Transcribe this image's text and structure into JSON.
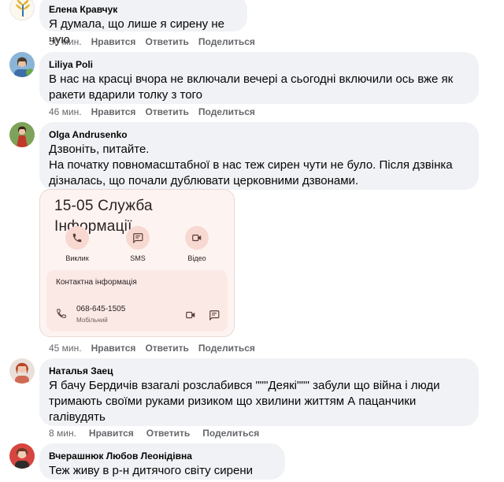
{
  "comments": [
    {
      "author": "Елена Кравчук",
      "text": "Я думала, що лише я сирену не чую",
      "time": "50 мин.",
      "like": "Нравится",
      "reply": "Ответить",
      "share": "Поделиться"
    },
    {
      "author": "Liliya Poli",
      "text": "В нас на красці вчора не включали вечері а сьогодні включили ось вже як\nракети вдарили толку з того",
      "time": "46 мин.",
      "like": "Нравится",
      "reply": "Ответить",
      "share": "Поделиться"
    },
    {
      "author": "Olga Andrusenko",
      "text": "Дзвоніть, питайте.\nНа початку повномасштабної в нас теж сирен чути не було. Після дзвінка\nдізналась, що почали дублювати церковними дзвонами.",
      "time": "45 мин.",
      "like": "Нравится",
      "reply": "Ответить",
      "share": "Поделиться",
      "attachment": {
        "title": "15-05 Служба Інформації",
        "actions": [
          {
            "label": "Виклик",
            "icon": "phone-icon"
          },
          {
            "label": "SMS",
            "icon": "message-icon"
          },
          {
            "label": "Відео",
            "icon": "video-icon"
          }
        ],
        "contact_header": "Контактна інформація",
        "phone": "068-645-1505",
        "phone_type": "Мобільний"
      }
    },
    {
      "author": "Наталья Заец",
      "text": "Я бачу Бердичів взагалі розслабився \"\"\"Деякі\"\"\" забули що війна і люди\nтримають своїми руками ризиком що хвилини життям А пацанчики\nгалівудять",
      "time": "8 мин.",
      "like": "Нравится",
      "reply": "Ответить",
      "share": "Поделиться"
    },
    {
      "author": "Вчерашнюк Любов Леонідівна",
      "text": "Теж живу в р-н дитячого світу сирени чути"
    }
  ],
  "colors": {
    "bubble": "#f0f2f5",
    "secondary_text": "#65676b",
    "card_bg": "#fdf4f1",
    "card_accent": "#f7d9d2"
  }
}
